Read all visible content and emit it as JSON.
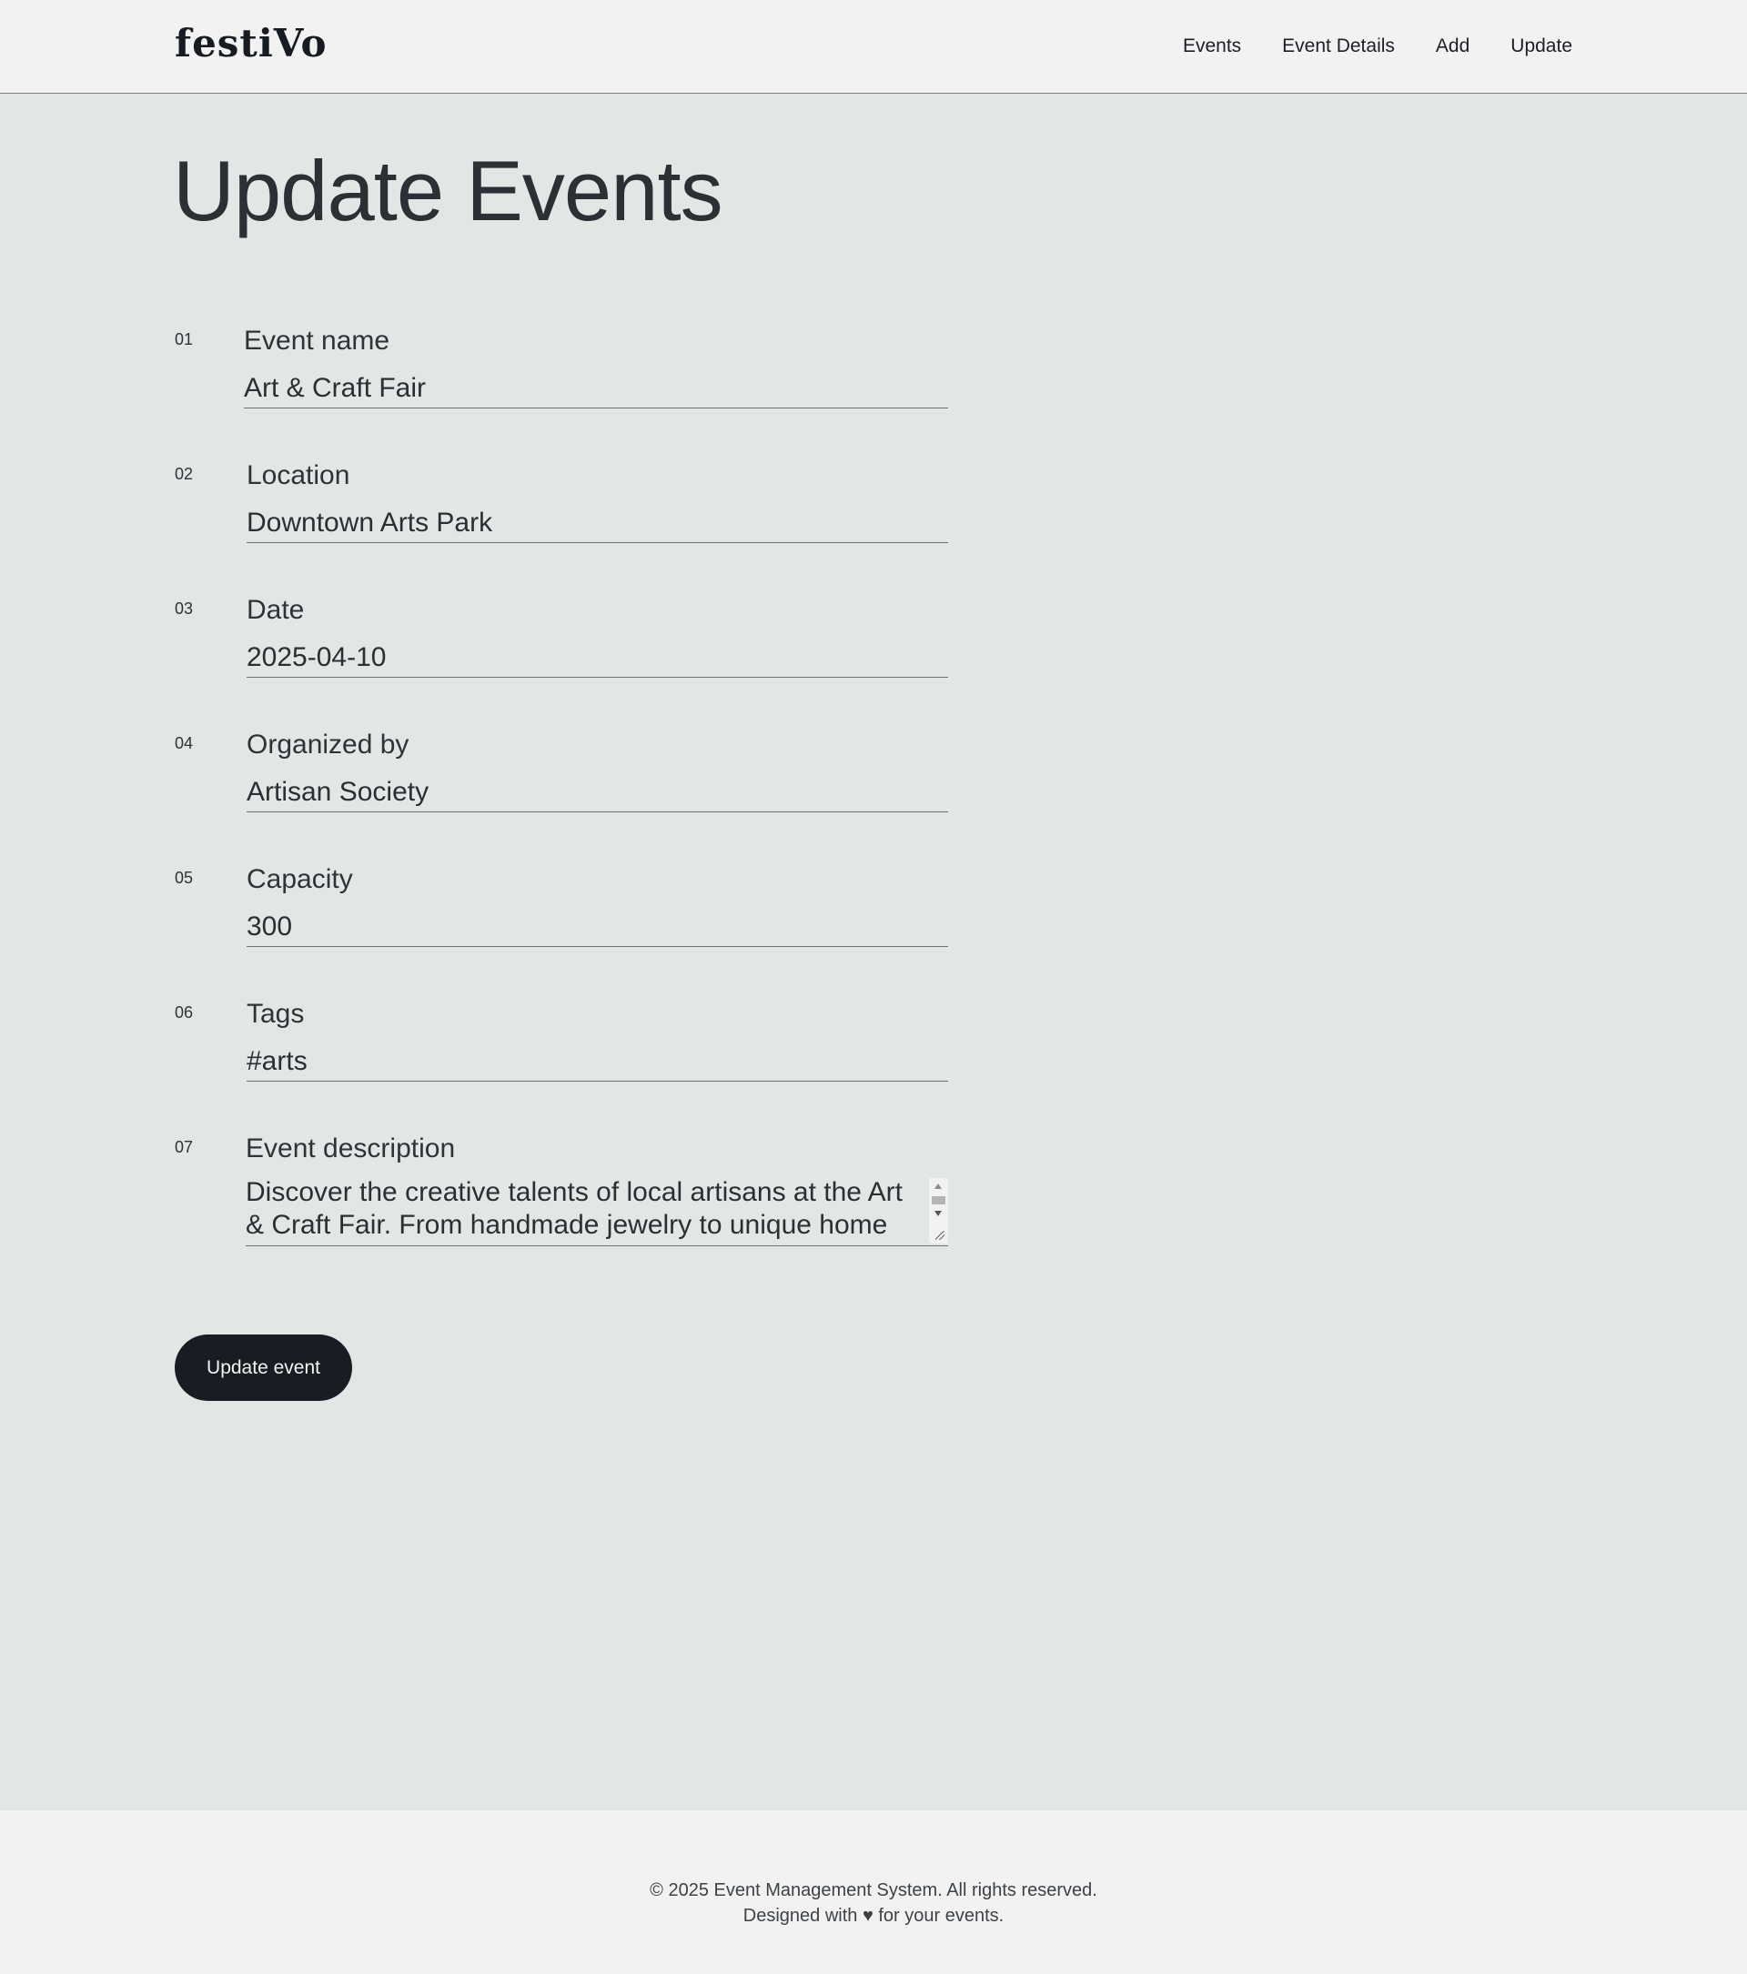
{
  "brand": {
    "logo_text": "festiVo"
  },
  "nav": {
    "items": [
      "Events",
      "Event Details",
      "Add",
      "Update"
    ]
  },
  "page": {
    "title": "Update Events"
  },
  "form": {
    "fields": [
      {
        "number": "01",
        "label": "Event name",
        "value": "Art & Craft Fair"
      },
      {
        "number": "02",
        "label": "Location",
        "value": "Downtown Arts Park"
      },
      {
        "number": "03",
        "label": "Date",
        "value": "2025-04-10"
      },
      {
        "number": "04",
        "label": "Organized by",
        "value": "Artisan Society"
      },
      {
        "number": "05",
        "label": "Capacity",
        "value": "300"
      },
      {
        "number": "06",
        "label": "Tags",
        "value": "#arts"
      },
      {
        "number": "07",
        "label": "Event description",
        "value": "Discover the creative talents of local artisans at the Art & Craft Fair. From handmade jewelry to unique home decor,"
      }
    ],
    "submit_label": "Update event"
  },
  "footer": {
    "copyright": "© 2025 Event Management System. All rights reserved.",
    "tagline": "Designed with ♥ for your events."
  },
  "colors": {
    "page_background": "#e2e6e5",
    "header_background": "#f2f2f2",
    "button_background": "#181c23",
    "button_text": "#f3f4f5"
  }
}
